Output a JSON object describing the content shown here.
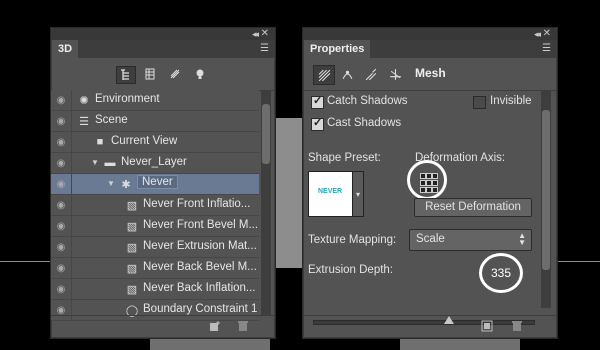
{
  "background": {
    "color": "#000000"
  },
  "panel3d": {
    "tab_label": "3D",
    "collapse_glyph": "◂◂",
    "close_glyph": "✕",
    "menu_glyph": "☰",
    "toolbar_icons": [
      "scene-filter-icon",
      "mesh-filter-icon",
      "material-filter-icon",
      "light-filter-icon"
    ],
    "layers": [
      {
        "label": "Environment",
        "icon": "environment-icon"
      },
      {
        "label": "Scene",
        "icon": "scene-icon"
      },
      {
        "label": "Current View",
        "icon": "camera-icon"
      },
      {
        "label": "Never_Layer",
        "icon": "folder-icon"
      },
      {
        "label": "Never",
        "icon": "mesh-icon",
        "selected": true
      },
      {
        "label": "Never Front Inflatio...",
        "icon": "material-icon"
      },
      {
        "label": "Never Front Bevel M...",
        "icon": "material-icon"
      },
      {
        "label": "Never Extrusion Mat...",
        "icon": "material-icon"
      },
      {
        "label": "Never Back Bevel M...",
        "icon": "material-icon"
      },
      {
        "label": "Never Back Inflation...",
        "icon": "material-icon"
      },
      {
        "label": "Boundary Constraint 1",
        "icon": "constraint-icon"
      }
    ]
  },
  "properties": {
    "tab_label": "Properties",
    "title": "Mesh",
    "catch_shadows": "Catch Shadows",
    "invisible": "Invisible",
    "cast_shadows": "Cast Shadows",
    "shape_preset": "Shape Preset:",
    "preset_thumb_text": "NEVER",
    "deformation_axis": "Deformation Axis:",
    "reset_deformation": "Reset Deformation",
    "texture_mapping_label": "Texture Mapping:",
    "texture_mapping_value": "Scale",
    "extrusion_depth_label": "Extrusion Depth:",
    "extrusion_depth_value": "335",
    "extrusion_slider_fraction": 0.62
  },
  "colors": {
    "panel_bg": "#535353",
    "selected_row": "#6a7a92",
    "highlight_circle": "#ffffff"
  }
}
